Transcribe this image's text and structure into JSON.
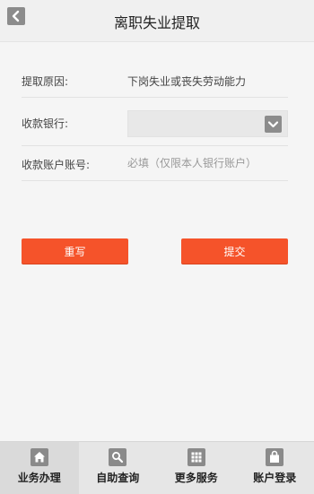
{
  "header": {
    "title": "离职失业提取",
    "back_icon": "chevron-left-icon"
  },
  "form": {
    "reason": {
      "label": "提取原因:",
      "value": "下岗失业或丧失劳动能力"
    },
    "bank": {
      "label": "收款银行:",
      "value": "",
      "arrow_icon": "chevron-down-icon"
    },
    "account": {
      "label": "收款账户账号:",
      "placeholder": "必填（仅限本人银行账户）",
      "value": ""
    }
  },
  "buttons": {
    "reset_label": "重写",
    "submit_label": "提交"
  },
  "colors": {
    "accent": "#f5532a",
    "icon_gray": "#8c8c8c"
  },
  "tabbar": {
    "items": [
      {
        "label": "业务办理",
        "icon": "home-icon",
        "active": true
      },
      {
        "label": "自助查询",
        "icon": "search-icon",
        "active": false
      },
      {
        "label": "更多服务",
        "icon": "grid-icon",
        "active": false
      },
      {
        "label": "账户登录",
        "icon": "bag-icon",
        "active": false
      }
    ]
  }
}
